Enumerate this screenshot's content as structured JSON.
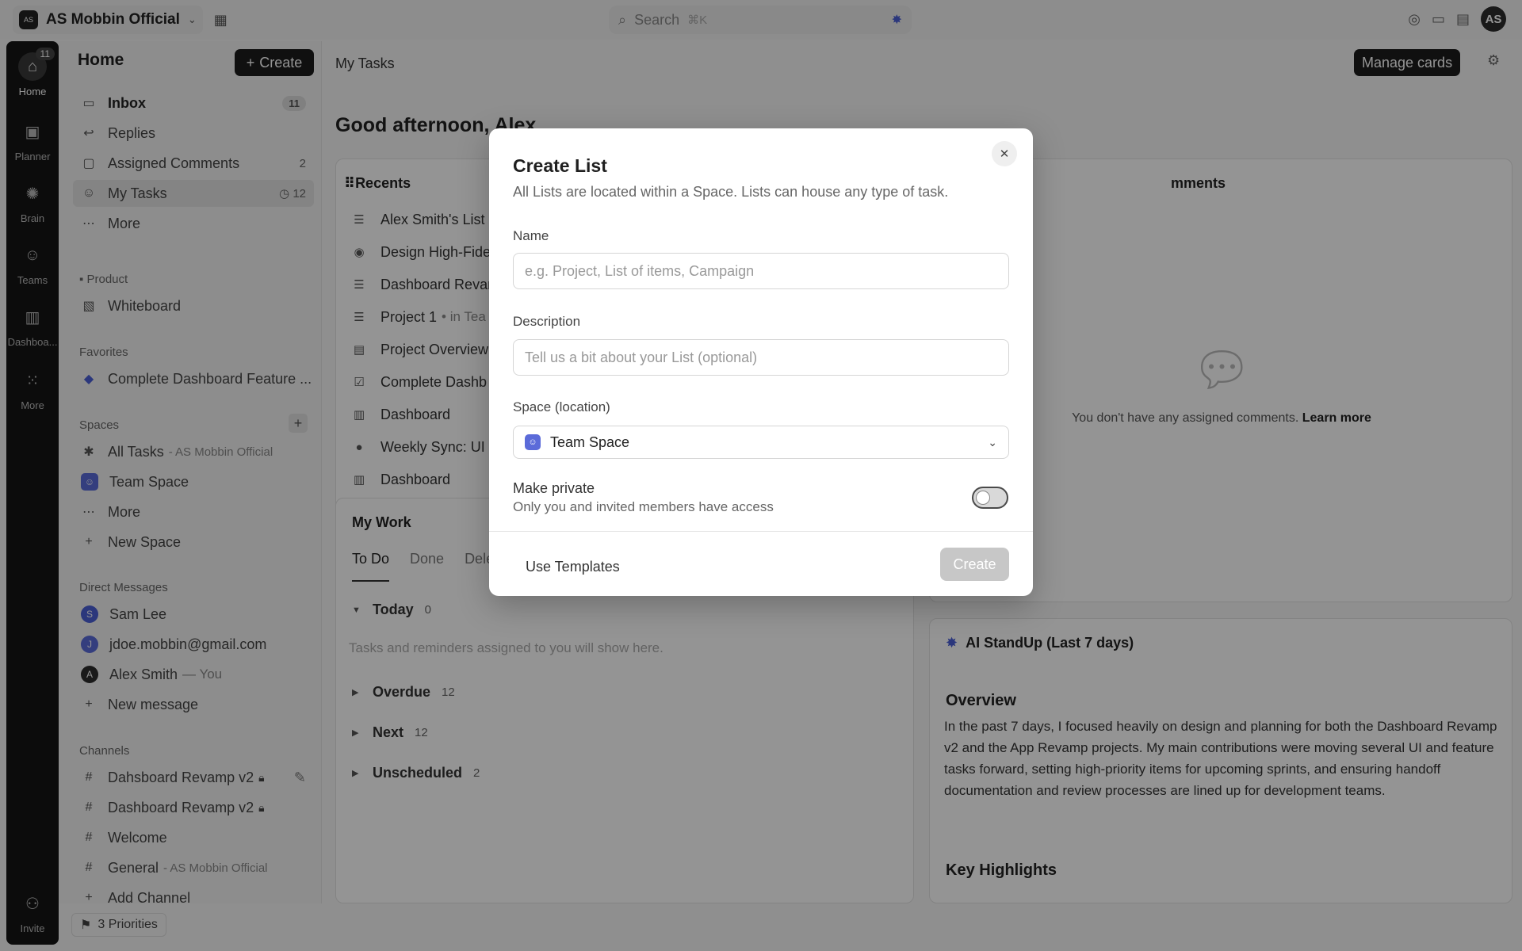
{
  "topbar": {
    "workspace_logo": "AS",
    "workspace_name": "AS Mobbin Official",
    "search_label": "Search",
    "search_shortcut": "⌘K",
    "avatar_initials": "AS"
  },
  "rail": {
    "home_badge": "11",
    "items": [
      {
        "label": "Home",
        "icon": "home-icon"
      },
      {
        "label": "Planner",
        "icon": "calendar-icon"
      },
      {
        "label": "Brain",
        "icon": "brain-icon"
      },
      {
        "label": "Teams",
        "icon": "teams-icon"
      },
      {
        "label": "Dashboa...",
        "icon": "dashboard-icon"
      },
      {
        "label": "More",
        "icon": "grid-icon"
      },
      {
        "label": "Invite",
        "icon": "invite-icon"
      }
    ]
  },
  "sidebar": {
    "title": "Home",
    "create_label": "Create",
    "nav": [
      {
        "label": "Inbox",
        "count": "11"
      },
      {
        "label": "Replies",
        "count": ""
      },
      {
        "label": "Assigned Comments",
        "count": "2"
      },
      {
        "label": "My Tasks",
        "count": "12"
      },
      {
        "label": "More",
        "count": ""
      }
    ],
    "product_section": "Product",
    "product_items": [
      "Whiteboard"
    ],
    "favorites_section": "Favorites",
    "favorites": [
      "Complete Dashboard Feature ..."
    ],
    "spaces_section": "Spaces",
    "spaces": [
      {
        "label": "All Tasks",
        "sub": "- AS Mobbin Official"
      },
      {
        "label": "Team Space",
        "sub": ""
      },
      {
        "label": "More",
        "sub": ""
      },
      {
        "label": "New Space",
        "sub": ""
      }
    ],
    "dm_section": "Direct Messages",
    "dms": [
      {
        "initial": "S",
        "label": "Sam Lee",
        "sub": "",
        "color": "#4b5fd6"
      },
      {
        "initial": "J",
        "label": "jdoe.mobbin@gmail.com",
        "sub": "",
        "color": "#5b6bd9"
      },
      {
        "initial": "A",
        "label": "Alex Smith",
        "sub": "— You",
        "color": "#2c2c2c"
      },
      {
        "initial": "",
        "label": "New message",
        "sub": "",
        "color": ""
      }
    ],
    "channels_section": "Channels",
    "channels": [
      {
        "label": "Dahsboard Revamp v2",
        "sub": ""
      },
      {
        "label": "Dashboard Revamp v2",
        "sub": ""
      },
      {
        "label": "Welcome",
        "sub": ""
      },
      {
        "label": "General",
        "sub": "- AS Mobbin Official"
      },
      {
        "label": "Add Channel",
        "sub": ""
      }
    ],
    "priorities_label": "3 Priorities"
  },
  "main": {
    "title": "My Tasks",
    "manage_cards_label": "Manage cards",
    "greeting": "Good afternoon, Alex",
    "recents": {
      "title": "Recents",
      "items": [
        {
          "label": "Alex Smith's List",
          "icon": "list-icon"
        },
        {
          "label": "Design High-Fide",
          "icon": "task-icon"
        },
        {
          "label": "Dashboard Revam",
          "icon": "list-icon"
        },
        {
          "label": "Project 1",
          "sub": "• in Tea",
          "icon": "list-icon"
        },
        {
          "label": "Project Overview",
          "icon": "doc-icon"
        },
        {
          "label": "Complete Dashb",
          "icon": "checkbox-icon"
        },
        {
          "label": "Dashboard",
          "icon": "dashboard-icon"
        },
        {
          "label": "Weekly Sync: UI",
          "icon": "task-icon"
        },
        {
          "label": "Dashboard",
          "icon": "dashboard-icon"
        }
      ]
    },
    "comments": {
      "title_fragment": "mments",
      "empty_text": "You don't have any assigned comments.",
      "learn_more": "Learn more"
    },
    "my_work": {
      "title": "My Work",
      "tabs": [
        "To Do",
        "Done",
        "Dele"
      ],
      "groups": [
        {
          "label": "Today",
          "count": "0"
        },
        {
          "label": "Overdue",
          "count": "12"
        },
        {
          "label": "Next",
          "count": "12"
        },
        {
          "label": "Unscheduled",
          "count": "2"
        }
      ],
      "empty_text": "Tasks and reminders assigned to you will show here."
    },
    "standup": {
      "title": "AI StandUp (Last 7 days)",
      "overview_heading": "Overview",
      "overview_text": "In the past 7 days, I focused heavily on design and planning for both the Dashboard Revamp v2 and the App Revamp projects. My main contributions were moving several UI and feature tasks forward, setting high-priority items for upcoming sprints, and ensuring handoff documentation and review processes are lined up for development teams.",
      "highlights_heading": "Key Highlights"
    }
  },
  "modal": {
    "title": "Create List",
    "subtitle": "All Lists are located within a Space. Lists can house any type of task.",
    "name_label": "Name",
    "name_placeholder": "e.g. Project, List of items, Campaign",
    "description_label": "Description",
    "description_placeholder": "Tell us a bit about your List (optional)",
    "space_label": "Space (location)",
    "space_value": "Team Space",
    "private_label": "Make private",
    "private_sub": "Only you and invited members have access",
    "private_on": false,
    "use_templates_label": "Use Templates",
    "create_label": "Create"
  }
}
